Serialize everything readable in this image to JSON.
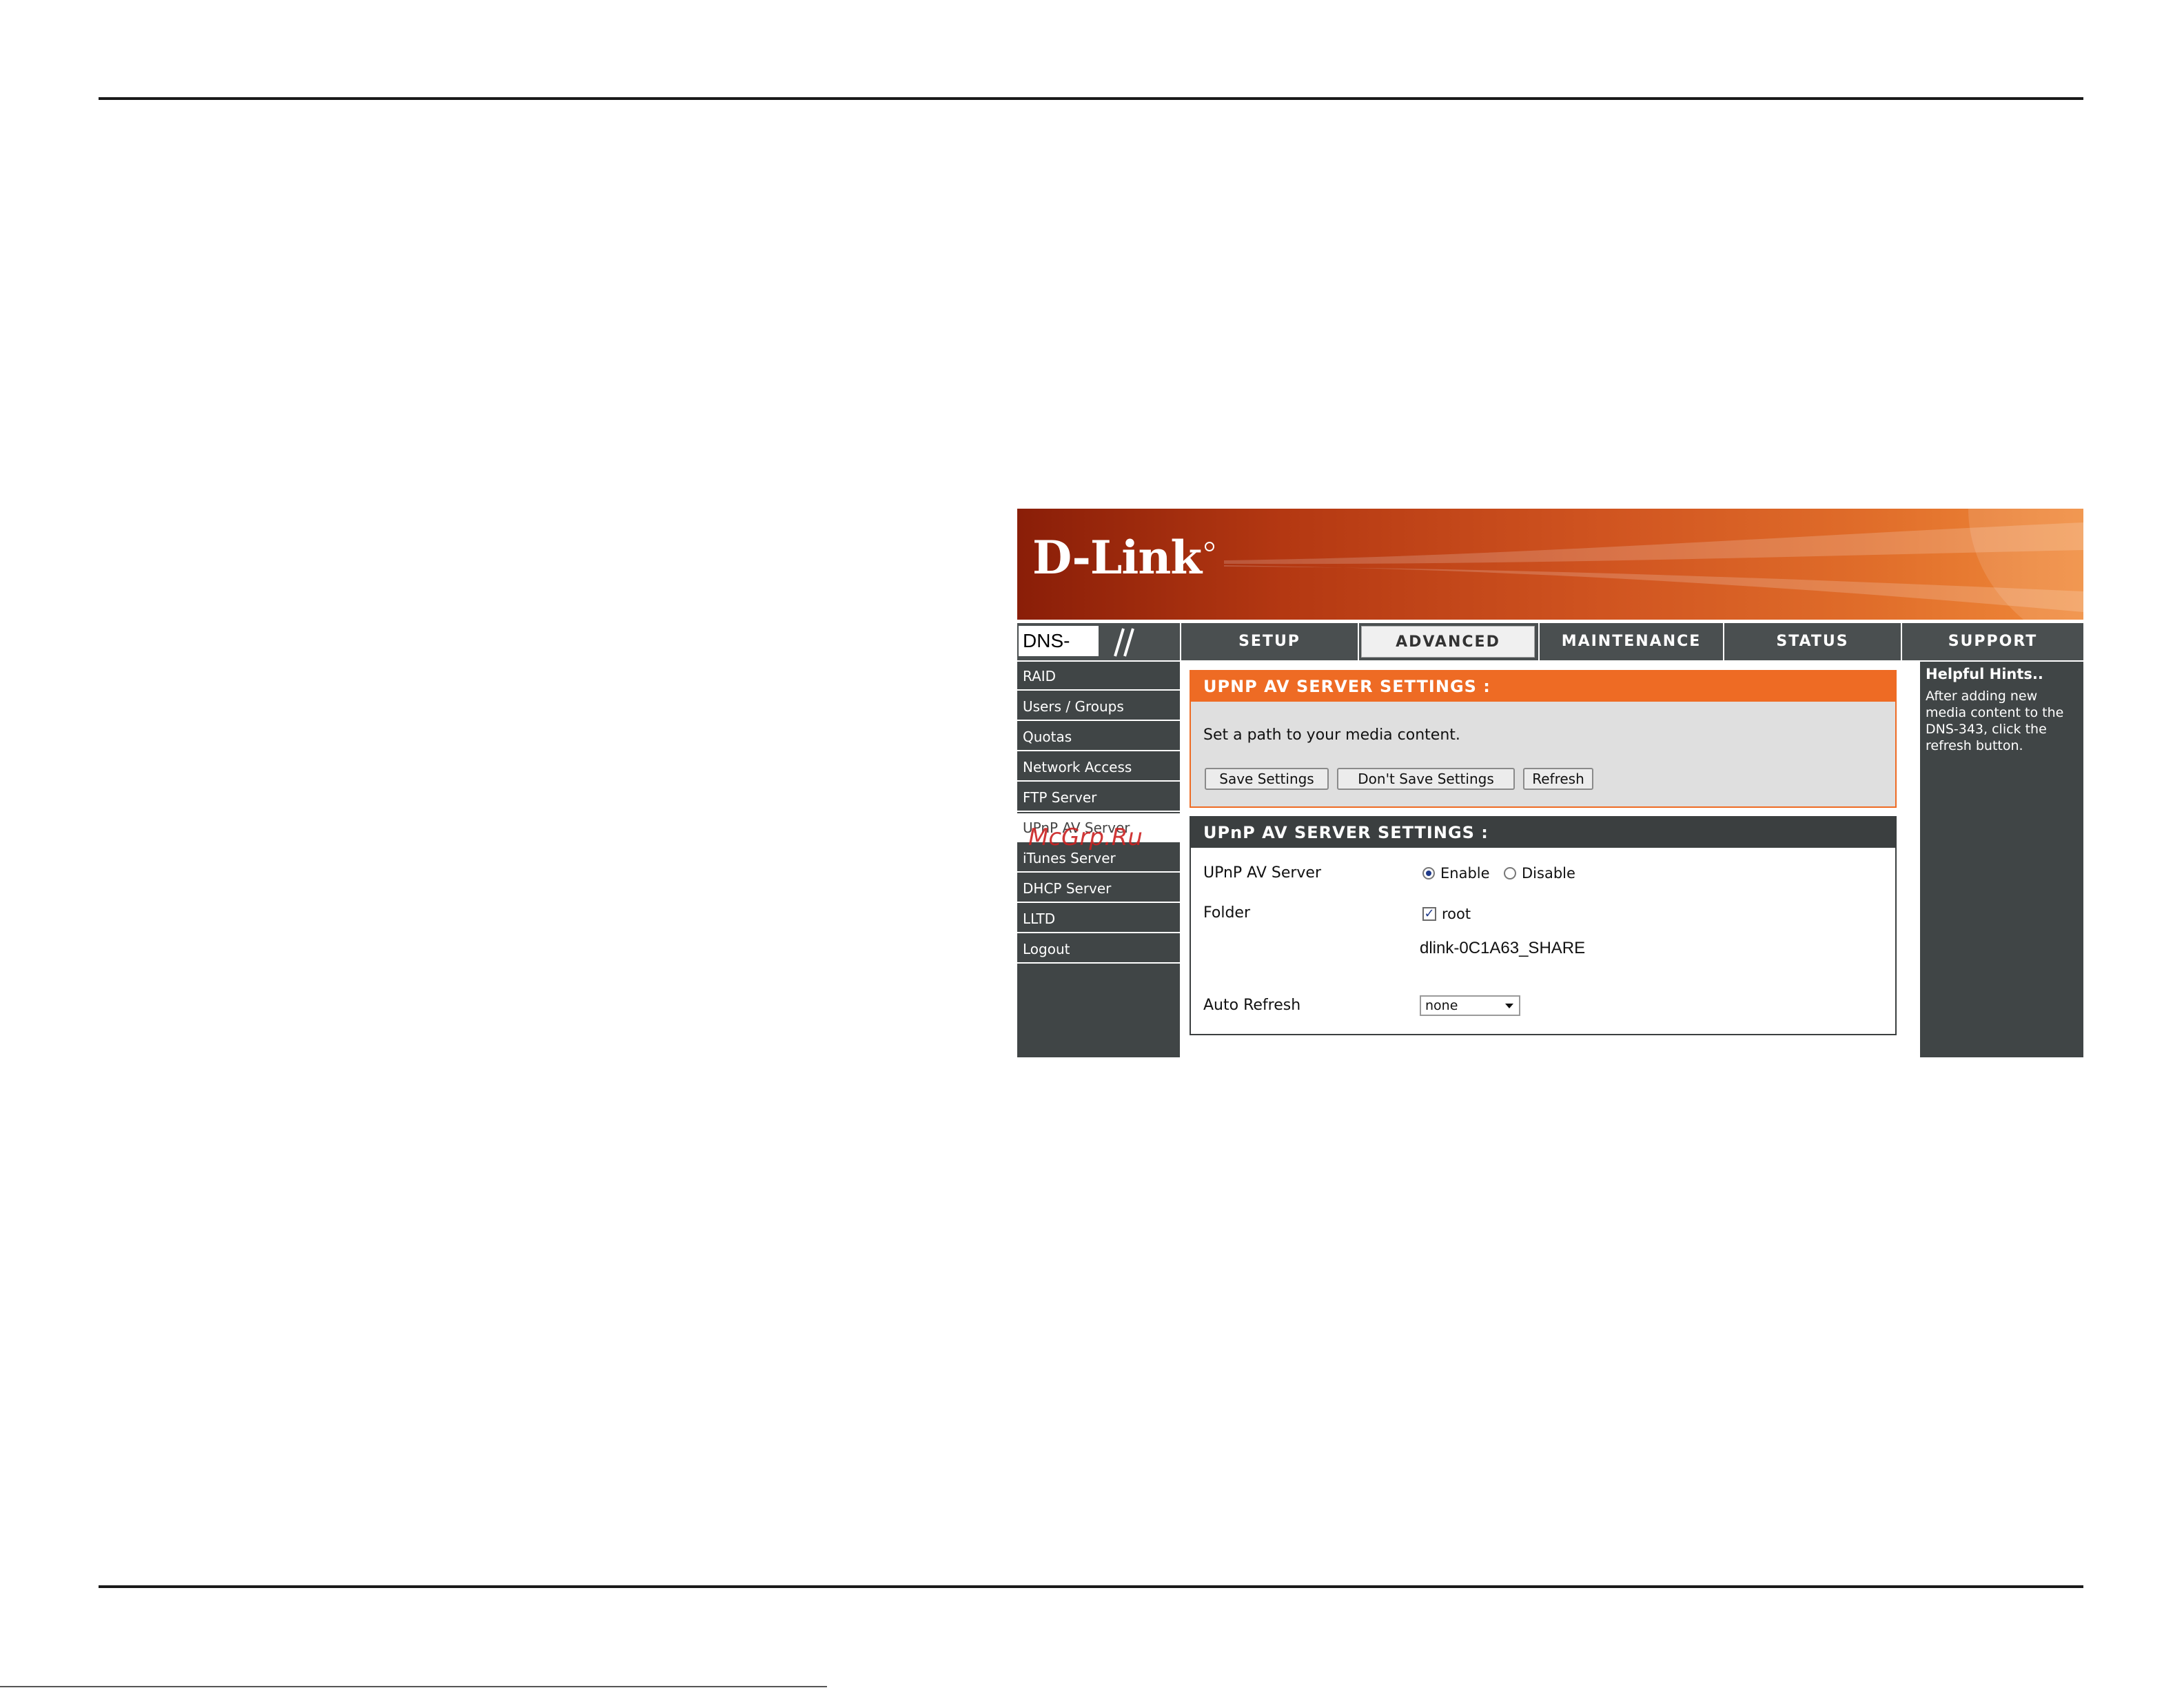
{
  "brand": {
    "logo": "D-Link",
    "model": "DNS-343"
  },
  "nav": {
    "tabs": [
      {
        "label": "SETUP"
      },
      {
        "label": "ADVANCED"
      },
      {
        "label": "MAINTENANCE"
      },
      {
        "label": "STATUS"
      },
      {
        "label": "SUPPORT"
      }
    ],
    "active": "ADVANCED"
  },
  "sidebar": {
    "items": [
      {
        "label": "RAID"
      },
      {
        "label": "Users / Groups"
      },
      {
        "label": "Quotas"
      },
      {
        "label": "Network Access"
      },
      {
        "label": "FTP Server"
      },
      {
        "label": "UPnP AV Server"
      },
      {
        "label": "iTunes Server"
      },
      {
        "label": "DHCP Server"
      },
      {
        "label": "LLTD"
      },
      {
        "label": "Logout"
      }
    ],
    "active": "UPnP AV Server",
    "watermark": "McGrp.Ru"
  },
  "panel1": {
    "title": "UPNP AV SERVER SETTINGS :",
    "description": "Set a path to your media content.",
    "buttons": {
      "save": "Save Settings",
      "dont_save": "Don't Save Settings",
      "refresh": "Refresh"
    }
  },
  "panel2": {
    "title": "UPnP AV SERVER SETTINGS :",
    "server": {
      "label": "UPnP AV Server",
      "enable": "Enable",
      "disable": "Disable",
      "selected": "Enable"
    },
    "folder": {
      "label": "Folder",
      "checkbox_label": "root",
      "checked": true,
      "share": "dlink-0C1A63_SHARE"
    },
    "auto_refresh": {
      "label": "Auto Refresh",
      "value": "none"
    }
  },
  "hints": {
    "title": "Helpful Hints..",
    "text": "After adding new media content to the DNS-343, click the refresh button."
  },
  "colors": {
    "accent_orange": "#ee6b24",
    "dark_gray": "#404546",
    "panel_gray": "#dfdfdf"
  }
}
